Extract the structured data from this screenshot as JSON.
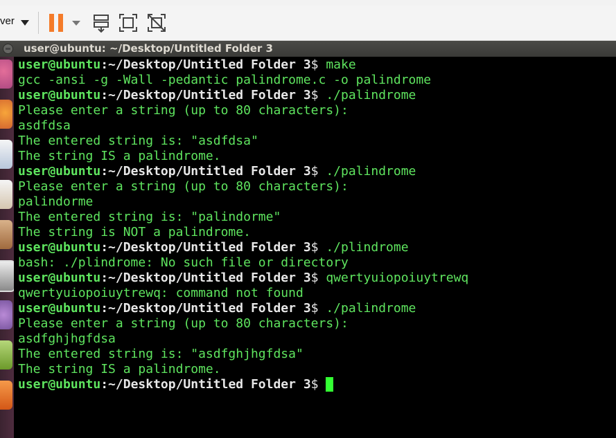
{
  "toolbar": {
    "menu_label": "ver",
    "icons": [
      "pause-icon",
      "send-keys-icon",
      "fullscreen-icon",
      "unity-mode-icon"
    ]
  },
  "terminal": {
    "title": "user@ubuntu: ~/Desktop/Untitled Folder 3",
    "prompt_user": "user@ubuntu",
    "prompt_path": ":~/Desktop/Untitled Folder 3",
    "prompt_symbol": "$",
    "lines": [
      {
        "type": "prompt",
        "cmd": " make"
      },
      {
        "type": "output",
        "text": "gcc -ansi -g -Wall -pedantic palindrome.c -o palindrome"
      },
      {
        "type": "prompt",
        "cmd": " ./palindrome"
      },
      {
        "type": "output",
        "text": "Please enter a string (up to 80 characters):"
      },
      {
        "type": "output",
        "text": "asdfdsa"
      },
      {
        "type": "output",
        "text": "The entered string is: \"asdfdsa\""
      },
      {
        "type": "output",
        "text": "The string IS a palindrome."
      },
      {
        "type": "prompt",
        "cmd": " ./palindrome"
      },
      {
        "type": "output",
        "text": "Please enter a string (up to 80 characters):"
      },
      {
        "type": "output",
        "text": "palindorme"
      },
      {
        "type": "output",
        "text": "The entered string is: \"palindorme\""
      },
      {
        "type": "output",
        "text": "The string is NOT a palindrome."
      },
      {
        "type": "prompt",
        "cmd": " ./plindrome"
      },
      {
        "type": "output",
        "text": "bash: ./plindrome: No such file or directory"
      },
      {
        "type": "prompt",
        "cmd": " qwertyuiopoiuytrewq"
      },
      {
        "type": "output",
        "text": "qwertyuiopoiuytrewq: command not found"
      },
      {
        "type": "prompt",
        "cmd": " ./palindrome"
      },
      {
        "type": "output",
        "text": "Please enter a string (up to 80 characters):"
      },
      {
        "type": "output",
        "text": "asdfghjhgfdsa"
      },
      {
        "type": "output",
        "text": "The entered string is: \"asdfghjhgfdsa\""
      },
      {
        "type": "output",
        "text": "The string IS a palindrome."
      },
      {
        "type": "prompt",
        "cmd": " ",
        "cursor": true
      }
    ]
  },
  "launcher": {
    "items": [
      "ubuntu-dash-icon",
      "firefox-icon",
      "writer-icon",
      "calc-icon",
      "files-icon",
      "terminal-icon",
      "app-icon",
      "download-icon",
      "software-center-icon"
    ]
  },
  "colors": {
    "terminal_text": "#5fe55f",
    "path_text": "#e8e8e8",
    "pause_orange": "#f47b2a",
    "titlebar": "#3c3b37"
  }
}
